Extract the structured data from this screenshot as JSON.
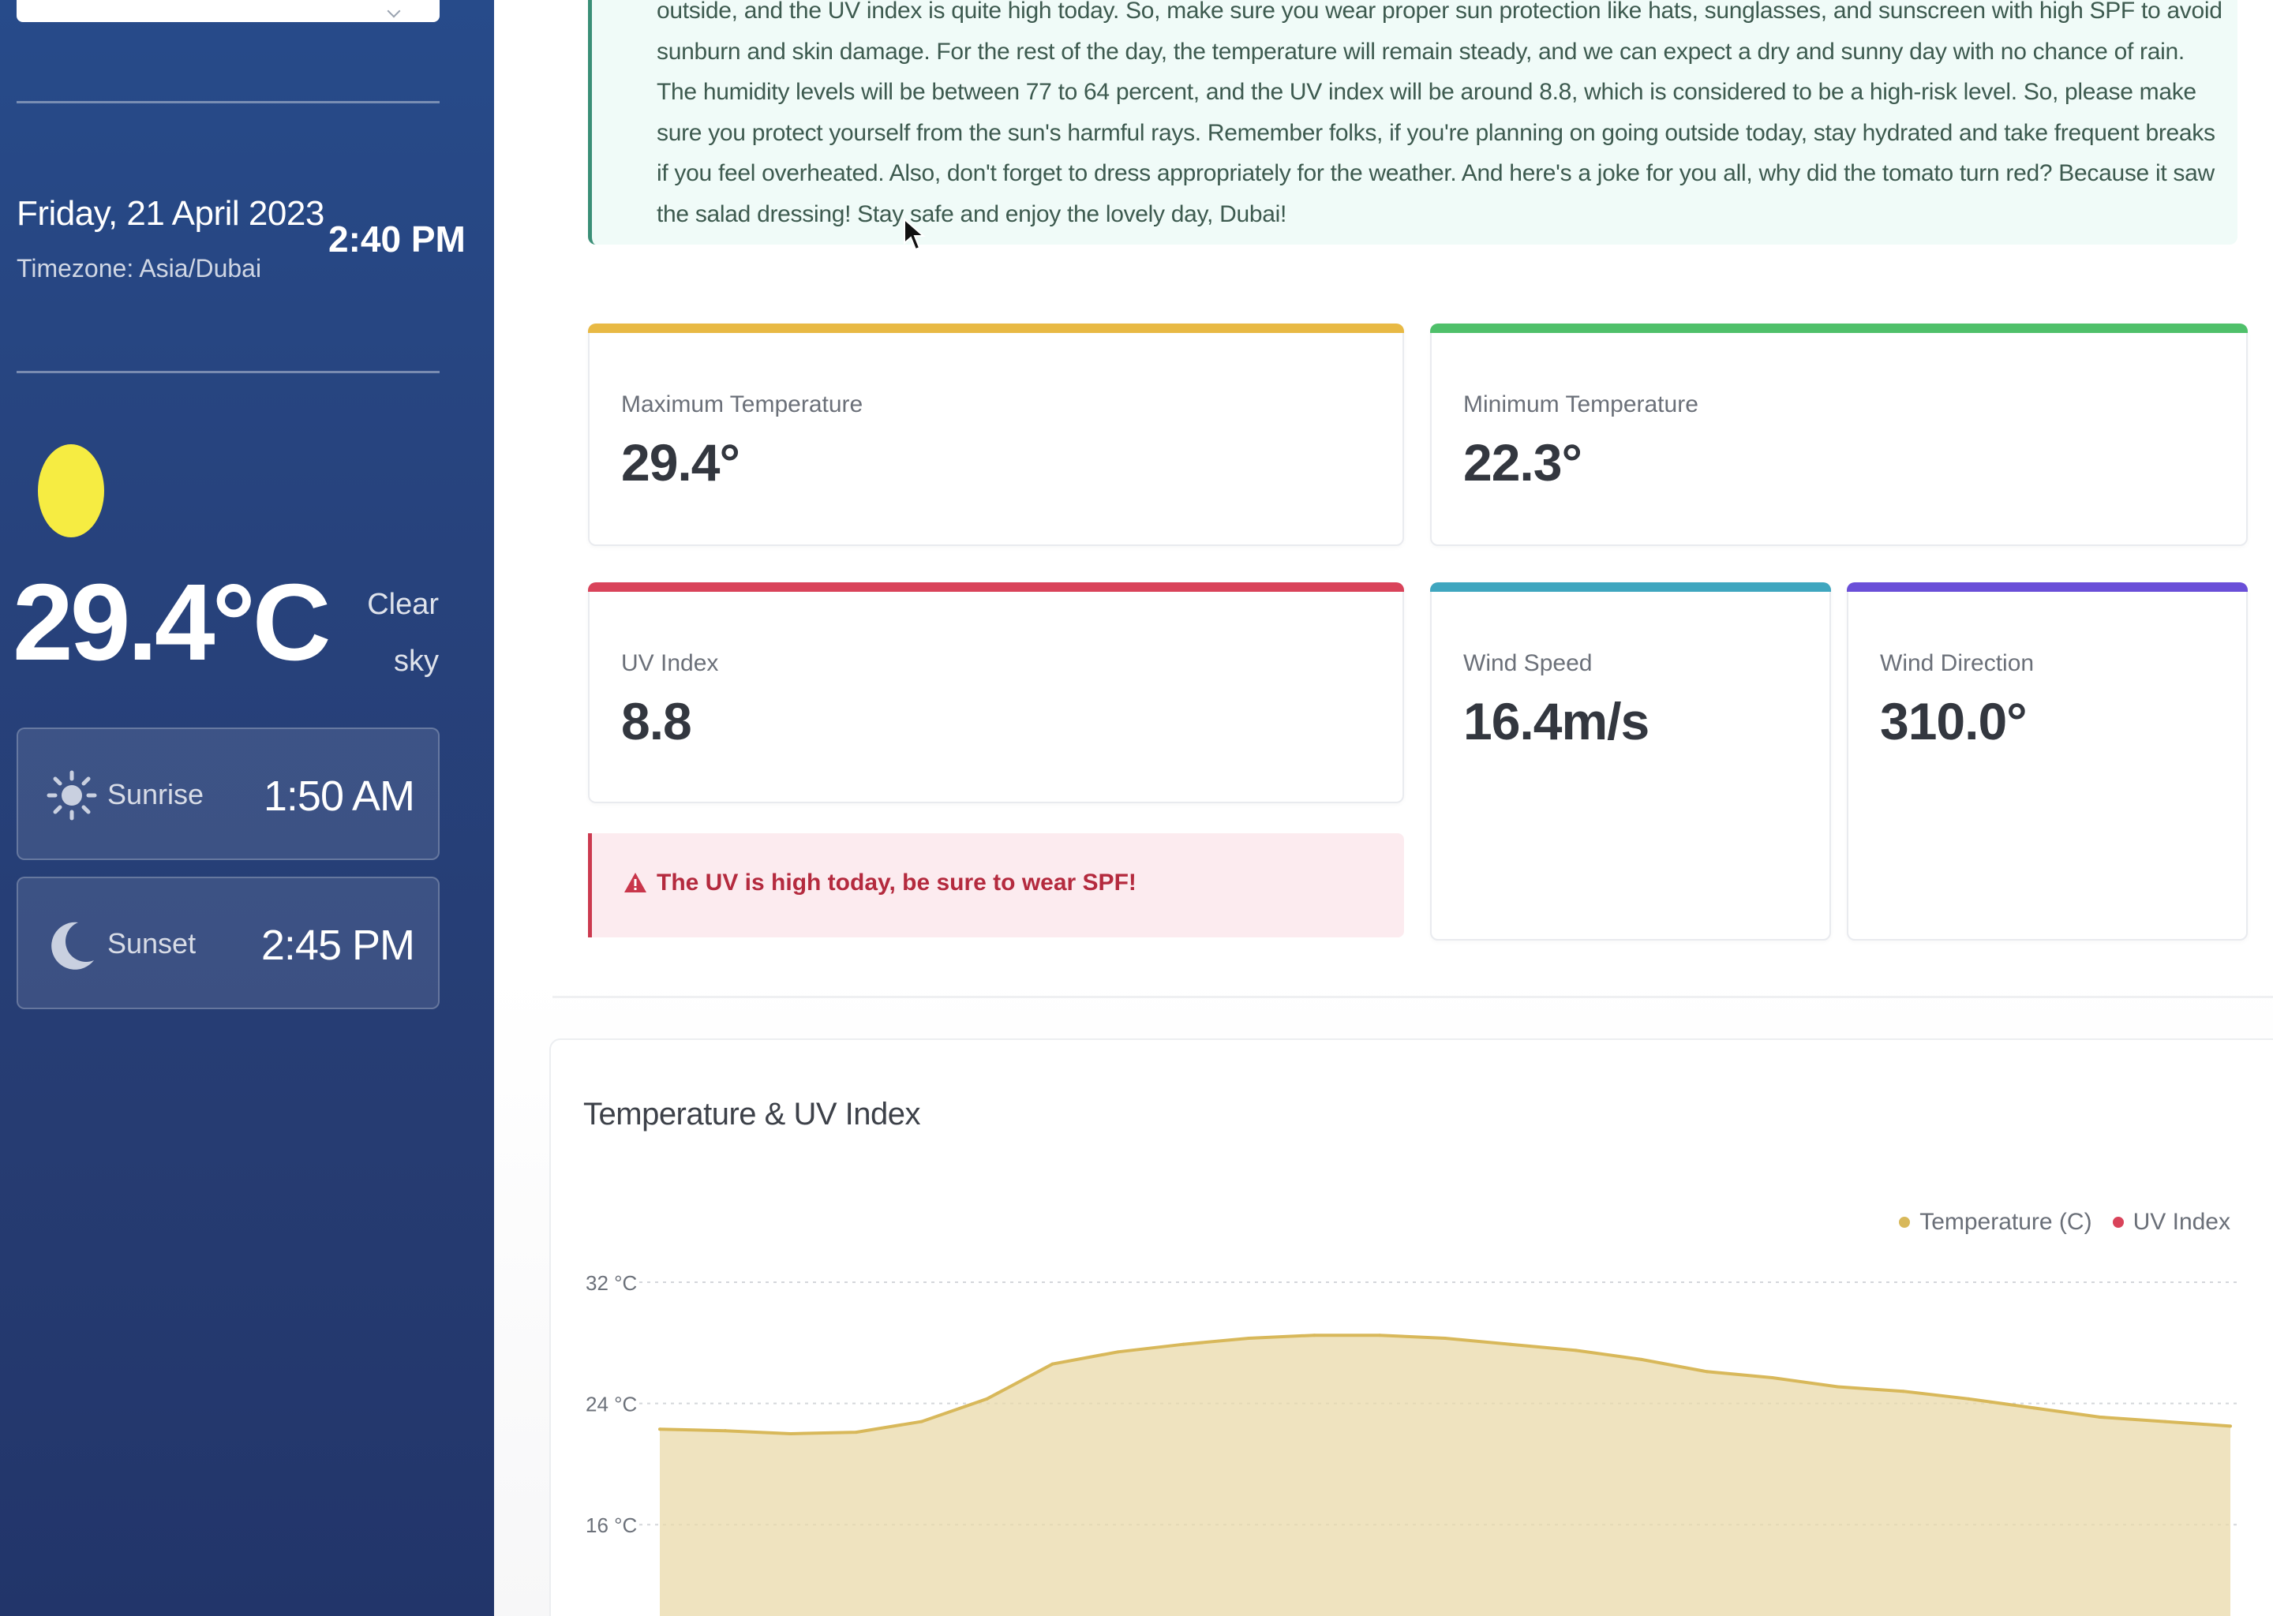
{
  "sidebar": {
    "date": "Friday, 21 April 2023",
    "timezone": "Timezone: Asia/Dubai",
    "time": "2:40 PM",
    "temperature": "29.4°C",
    "condition_line1": "Clear",
    "condition_line2": "sky",
    "sunrise": {
      "label": "Sunrise",
      "value": "1:50 AM",
      "icon": "sun-icon"
    },
    "sunset": {
      "label": "Sunset",
      "value": "2:45 PM",
      "icon": "moon-icon"
    }
  },
  "summary": {
    "text": "outside, and the UV index is quite high today. So, make sure you wear proper sun protection like hats, sunglasses, and sunscreen with high SPF to avoid sunburn and skin damage. For the rest of the day, the temperature will remain steady, and we can expect a dry and sunny day with no chance of rain. The humidity levels will be between 77 to 64 percent, and the UV index will be around 8.8, which is considered to be a high-risk level. So, please make sure you protect yourself from the sun's harmful rays. Remember folks, if you're planning on going outside today, stay hydrated and take frequent breaks if you feel overheated. Also, don't forget to dress appropriately for the weather. And here's a joke for you all, why did the tomato turn red? Because it saw the salad dressing! Stay safe and enjoy the lovely day, Dubai!"
  },
  "stats": {
    "max_temp": {
      "label": "Maximum Temperature",
      "value": "29.4°",
      "color": "#e8b944"
    },
    "min_temp": {
      "label": "Minimum Temperature",
      "value": "22.3°",
      "color": "#4fc06a"
    },
    "uv_index": {
      "label": "UV Index",
      "value": "8.8",
      "color": "#d9435a"
    },
    "wind_speed": {
      "label": "Wind Speed",
      "value": "16.4m/s",
      "color": "#3fa6bf"
    },
    "wind_direction": {
      "label": "Wind Direction",
      "value": "310.0°",
      "color": "#6a4fd8"
    }
  },
  "alert": {
    "text": "The UV is high today, be sure to wear SPF!",
    "icon": "warning-icon"
  },
  "chart_data": {
    "type": "area",
    "title": "Temperature & UV Index",
    "legend_position": "top-right",
    "series": [
      {
        "name": "Temperature (C)",
        "color": "#d8b85a",
        "values": [
          22.3,
          22.2,
          22.0,
          22.1,
          22.8,
          24.3,
          26.6,
          27.4,
          27.9,
          28.3,
          28.5,
          28.5,
          28.3,
          27.9,
          27.5,
          26.9,
          26.1,
          25.7,
          25.1,
          24.8,
          24.3,
          23.7,
          23.1,
          22.8,
          22.5
        ]
      },
      {
        "name": "UV Index",
        "color": "#d9435a",
        "values": []
      }
    ],
    "y_ticks": [
      "32 °C",
      "24 °C",
      "16 °C"
    ],
    "y_tick_values": [
      32,
      24,
      16
    ],
    "grid": true
  }
}
